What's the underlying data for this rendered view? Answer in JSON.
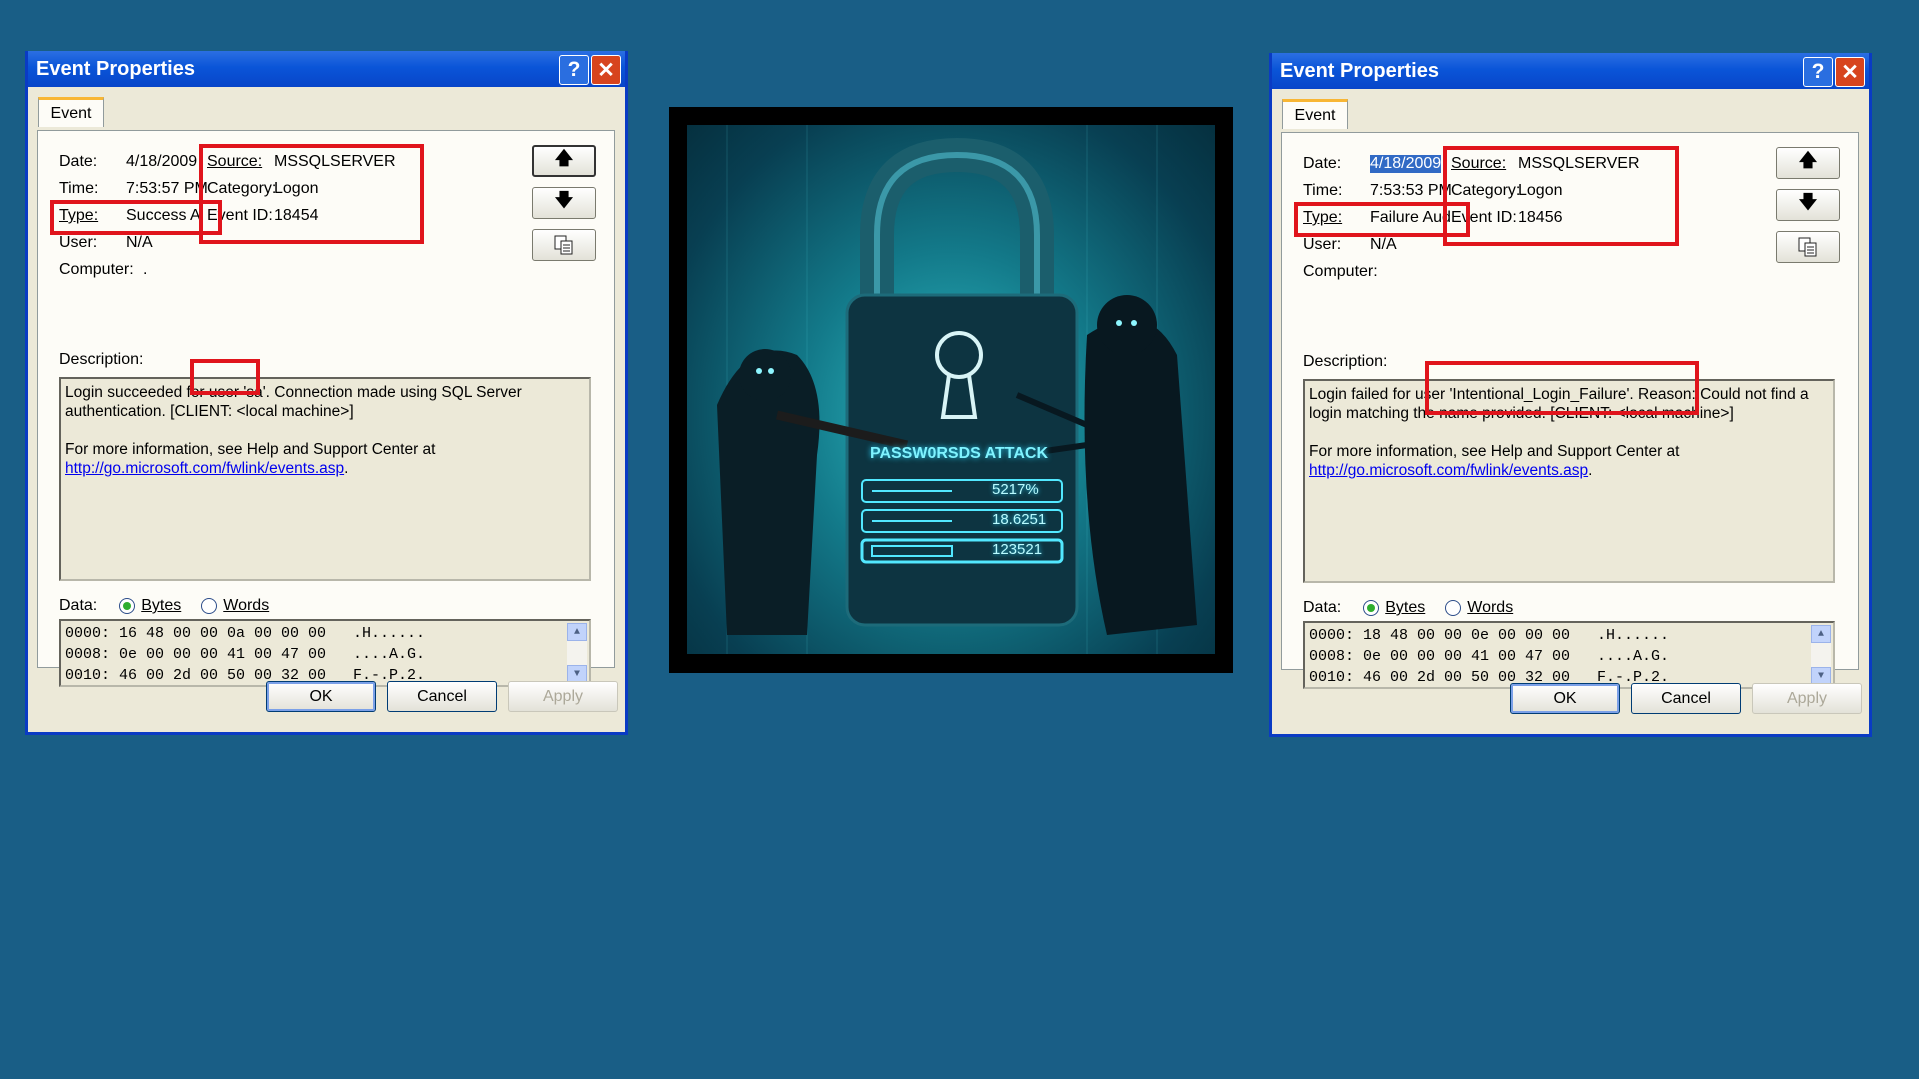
{
  "left_dialog": {
    "title": "Event Properties",
    "help_glyph": "?",
    "close_glyph": "✕",
    "tab": "Event",
    "fields": {
      "date_label": "Date:",
      "date": "4/18/2009",
      "time_label": "Time:",
      "time": "7:53:57 PM",
      "type_label": "Type:",
      "type": "Success A",
      "user_label": "User:",
      "user": "N/A",
      "computer_label": "Computer:",
      "computer": ".",
      "source_label": "Source:",
      "source": "MSSQLSERVER",
      "category_label": "Category:",
      "category": "Logon",
      "eventid_label": "Event ID:",
      "eventid": "18454"
    },
    "description_label": "Description:",
    "description_line1": "Login succeeded for user 'sa'. Connection made using SQL Server",
    "description_line2": "authentication. [CLIENT: <local machine>]",
    "description_more": "For more information, see Help and Support Center at",
    "description_link": "http://go.microsoft.com/fwlink/events.asp",
    "description_link_suffix": ".",
    "data_label": "Data:",
    "radio_bytes": "Bytes",
    "radio_words": "Words",
    "hex_lines": [
      "0000: 16 48 00 00 0a 00 00 00   .H......",
      "0008: 0e 00 00 00 41 00 47 00   ....A.G.",
      "0010: 46 00 2d 00 50 00 32 00   F.-.P.2."
    ],
    "ok": "OK",
    "cancel": "Cancel",
    "apply": "Apply"
  },
  "right_dialog": {
    "title": "Event Properties",
    "help_glyph": "?",
    "close_glyph": "✕",
    "tab": "Event",
    "fields": {
      "date_label": "Date:",
      "date": "4/18/2009",
      "time_label": "Time:",
      "time": "7:53:53 PM",
      "type_label": "Type:",
      "type": "Failure Aud",
      "user_label": "User:",
      "user": "N/A",
      "computer_label": "Computer:",
      "computer": "",
      "source_label": "Source:",
      "source": "MSSQLSERVER",
      "category_label": "Category:",
      "category": "Logon",
      "eventid_label": "Event ID:",
      "eventid": "18456"
    },
    "description_label": "Description:",
    "description_line1": "Login failed for user 'Intentional_Login_Failure'. Reason: Could not find a",
    "description_line2": "login matching the name provided. [CLIENT: <local machine>]",
    "description_more": "For more information, see Help and Support Center at",
    "description_link": "http://go.microsoft.com/fwlink/events.asp",
    "description_link_suffix": ".",
    "data_label": "Data:",
    "radio_bytes": "Bytes",
    "radio_words": "Words",
    "hex_lines": [
      "0000: 18 48 00 00 0e 00 00 00   .H......",
      "0008: 0e 00 00 00 41 00 47 00   ....A.G.",
      "0010: 46 00 2d 00 50 00 32 00   F.-.P.2."
    ],
    "ok": "OK",
    "cancel": "Cancel",
    "apply": "Apply"
  },
  "illustration": {
    "banner": "PASSW0RSDS ATTACK",
    "bars": [
      "5217%",
      "18.6251",
      "123521"
    ]
  },
  "icons": {
    "up": "arrow-up-icon",
    "down": "arrow-down-icon",
    "copy": "copy-icon"
  },
  "colors": {
    "background": "#195e86",
    "highlight_box": "#e0141c",
    "titlebar": "#0a55d8"
  }
}
